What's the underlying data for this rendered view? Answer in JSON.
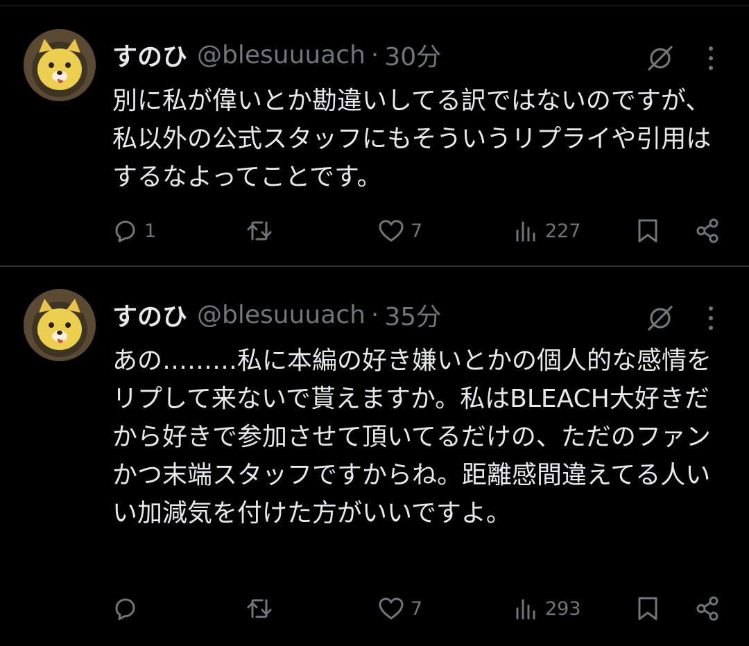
{
  "tweets": [
    {
      "name": "すのひ",
      "handle": "@blesuuuach",
      "separator": "·",
      "time": "30分",
      "text": "別に私が偉いとか勘違いしてる訳ではないのですが、私以外の公式スタッフにもそういうリプライや引用はするなよってことです。",
      "stats": {
        "replies": "1",
        "retweets": "",
        "likes": "7",
        "views": "227"
      }
    },
    {
      "name": "すのひ",
      "handle": "@blesuuuach",
      "separator": "·",
      "time": "35分",
      "text": "あの………私に本編の好き嫌いとかの個人的な感情をリプして来ないで貰えますか。私はBLEACH大好きだから好きで参加させて頂いてるだけの、ただのファンかつ末端スタッフですからね。距離感間違えてる人いい加減気を付けた方がいいですよ。",
      "stats": {
        "replies": "",
        "retweets": "",
        "likes": "7",
        "views": "293"
      }
    }
  ],
  "icons": {
    "reply": "reply-icon",
    "retweet": "retweet-icon",
    "like": "heart-icon",
    "views": "views-icon",
    "bookmark": "bookmark-icon",
    "share": "share-icon",
    "grok": "grok-icon",
    "more": "more-icon"
  },
  "colors": {
    "background": "#000000",
    "text": "#e7e9ea",
    "muted": "#71767b",
    "divider": "#2f3336"
  }
}
